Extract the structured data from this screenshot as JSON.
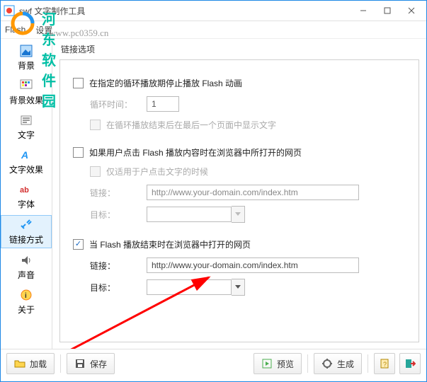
{
  "watermark": {
    "text": "河东软件园",
    "url": "www.pc0359.cn"
  },
  "window": {
    "title": "swf 文字制作工具"
  },
  "menus": {
    "flash": "Flash",
    "settings": "设置"
  },
  "sidebar": {
    "items": [
      {
        "label": "背景"
      },
      {
        "label": "背景效果"
      },
      {
        "label": "文字"
      },
      {
        "label": "文字效果"
      },
      {
        "label": "字体"
      },
      {
        "label": "链接方式"
      },
      {
        "label": "声音"
      },
      {
        "label": "关于"
      }
    ]
  },
  "panel": {
    "title": "链接选项",
    "section1": {
      "checkbox": "在指定的循环播放期停止播放 Flash 动画",
      "loop_label": "循环时间：",
      "loop_value": "1",
      "sub_checkbox": "在循环播放结束后在最后一个页面中显示文字"
    },
    "section2": {
      "checkbox": "如果用户点击 Flash 播放内容时在浏览器中所打开的网页",
      "sub_checkbox": "仅适用于户点击文字的时候",
      "link_label": "链接：",
      "link_value": "http://www.your-domain.com/index.htm",
      "target_label": "目标："
    },
    "section3": {
      "checkbox": "当 Flash 播放结束时在浏览器中打开的网页",
      "link_label": "链接：",
      "link_value": "http://www.your-domain.com/index.htm",
      "target_label": "目标："
    }
  },
  "bottombar": {
    "load": "加载",
    "save": "保存",
    "preview": "预览",
    "build": "生成"
  }
}
